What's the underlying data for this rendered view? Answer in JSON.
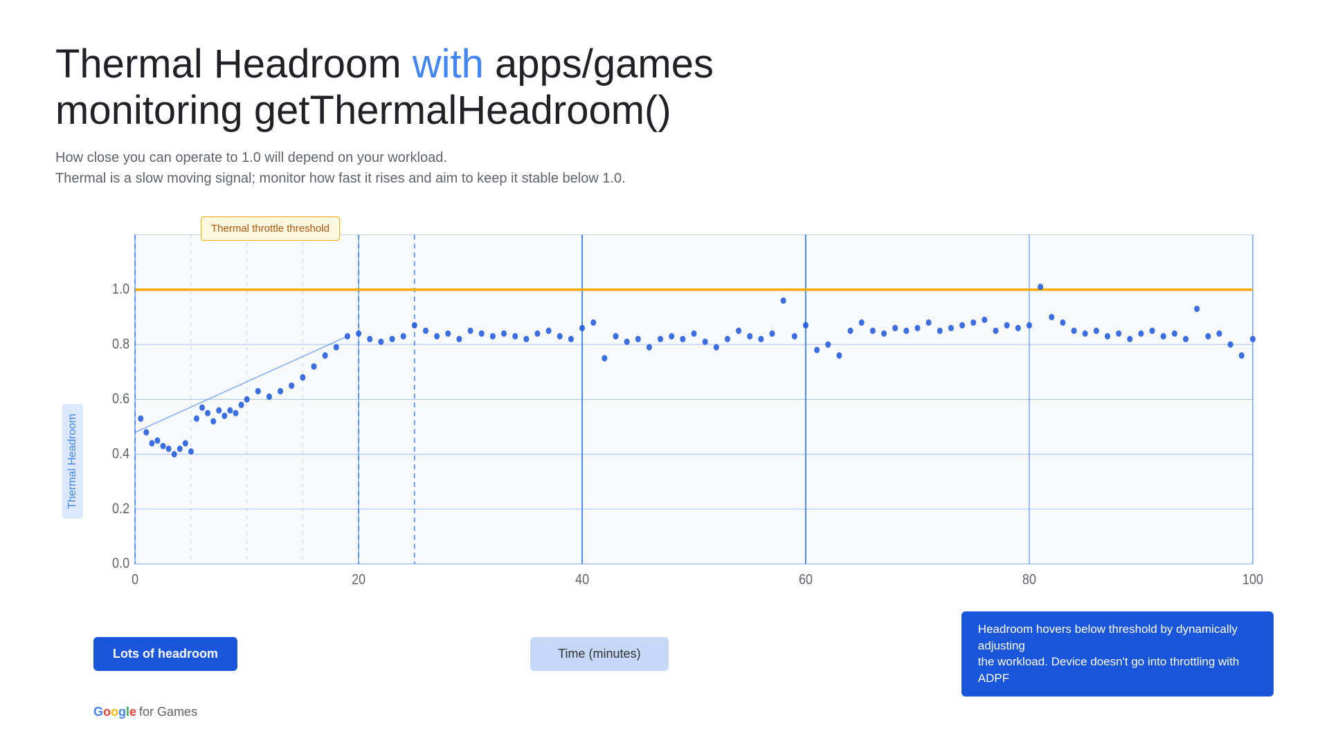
{
  "title": {
    "part1": "Thermal Headroom ",
    "with": "with",
    "part2": " apps/games",
    "line2": "monitoring getThermalHeadroom()"
  },
  "subtitle": {
    "line1": "How close you can operate to 1.0 will depend on your workload.",
    "line2": "Thermal is a slow moving signal; monitor how fast it rises and aim to keep it stable below 1.0."
  },
  "chart": {
    "y_axis_label": "Thermal Headroom",
    "x_axis_label": "Time (minutes)",
    "y_ticks": [
      "1.0",
      "0.8",
      "0.6",
      "0.4",
      "0.2",
      "0.0"
    ],
    "x_ticks": [
      "0",
      "20",
      "40",
      "60",
      "80",
      "100"
    ],
    "threshold_label": "Thermal throttle threshold",
    "threshold_value": 1.0
  },
  "labels": {
    "lots_headroom": "Lots of headroom",
    "time_minutes": "Time (minutes)",
    "headroom_desc": "Headroom hovers below threshold by dynamically adjusting\nthe workload. Device doesn't go into throttling with ADPF"
  },
  "google_logo": {
    "text": "Google",
    "suffix": " for Games"
  },
  "colors": {
    "blue": "#4285F4",
    "yellow": "#f9ab00",
    "dark_blue": "#1a56db",
    "red": "#EA4335",
    "green": "#34A853",
    "text_dark": "#202124",
    "text_gray": "#5f6368"
  },
  "data_points": [
    {
      "t": 0.5,
      "v": 0.53
    },
    {
      "t": 1.0,
      "v": 0.48
    },
    {
      "t": 1.5,
      "v": 0.44
    },
    {
      "t": 2.0,
      "v": 0.45
    },
    {
      "t": 2.5,
      "v": 0.43
    },
    {
      "t": 3.0,
      "v": 0.42
    },
    {
      "t": 3.5,
      "v": 0.4
    },
    {
      "t": 4.0,
      "v": 0.42
    },
    {
      "t": 4.5,
      "v": 0.44
    },
    {
      "t": 5.0,
      "v": 0.41
    },
    {
      "t": 5.5,
      "v": 0.53
    },
    {
      "t": 6.0,
      "v": 0.57
    },
    {
      "t": 6.5,
      "v": 0.55
    },
    {
      "t": 7.0,
      "v": 0.52
    },
    {
      "t": 7.5,
      "v": 0.56
    },
    {
      "t": 8.0,
      "v": 0.54
    },
    {
      "t": 8.5,
      "v": 0.56
    },
    {
      "t": 9.0,
      "v": 0.55
    },
    {
      "t": 9.5,
      "v": 0.58
    },
    {
      "t": 10.0,
      "v": 0.6
    },
    {
      "t": 11.0,
      "v": 0.63
    },
    {
      "t": 12.0,
      "v": 0.61
    },
    {
      "t": 13.0,
      "v": 0.63
    },
    {
      "t": 14.0,
      "v": 0.65
    },
    {
      "t": 15.0,
      "v": 0.68
    },
    {
      "t": 16.0,
      "v": 0.72
    },
    {
      "t": 17.0,
      "v": 0.76
    },
    {
      "t": 18.0,
      "v": 0.79
    },
    {
      "t": 19.0,
      "v": 0.83
    },
    {
      "t": 20.0,
      "v": 0.84
    },
    {
      "t": 21.0,
      "v": 0.82
    },
    {
      "t": 22.0,
      "v": 0.81
    },
    {
      "t": 23.0,
      "v": 0.82
    },
    {
      "t": 24.0,
      "v": 0.83
    },
    {
      "t": 25.0,
      "v": 0.87
    },
    {
      "t": 26.0,
      "v": 0.85
    },
    {
      "t": 27.0,
      "v": 0.83
    },
    {
      "t": 28.0,
      "v": 0.84
    },
    {
      "t": 29.0,
      "v": 0.82
    },
    {
      "t": 30.0,
      "v": 0.85
    },
    {
      "t": 31.0,
      "v": 0.84
    },
    {
      "t": 32.0,
      "v": 0.83
    },
    {
      "t": 33.0,
      "v": 0.84
    },
    {
      "t": 34.0,
      "v": 0.83
    },
    {
      "t": 35.0,
      "v": 0.82
    },
    {
      "t": 36.0,
      "v": 0.84
    },
    {
      "t": 37.0,
      "v": 0.85
    },
    {
      "t": 38.0,
      "v": 0.83
    },
    {
      "t": 39.0,
      "v": 0.82
    },
    {
      "t": 40.0,
      "v": 0.86
    },
    {
      "t": 41.0,
      "v": 0.88
    },
    {
      "t": 42.0,
      "v": 0.75
    },
    {
      "t": 43.0,
      "v": 0.83
    },
    {
      "t": 44.0,
      "v": 0.81
    },
    {
      "t": 45.0,
      "v": 0.82
    },
    {
      "t": 46.0,
      "v": 0.79
    },
    {
      "t": 47.0,
      "v": 0.82
    },
    {
      "t": 48.0,
      "v": 0.83
    },
    {
      "t": 49.0,
      "v": 0.82
    },
    {
      "t": 50.0,
      "v": 0.84
    },
    {
      "t": 51.0,
      "v": 0.81
    },
    {
      "t": 52.0,
      "v": 0.79
    },
    {
      "t": 53.0,
      "v": 0.82
    },
    {
      "t": 54.0,
      "v": 0.85
    },
    {
      "t": 55.0,
      "v": 0.83
    },
    {
      "t": 56.0,
      "v": 0.82
    },
    {
      "t": 57.0,
      "v": 0.84
    },
    {
      "t": 58.0,
      "v": 0.96
    },
    {
      "t": 59.0,
      "v": 0.83
    },
    {
      "t": 60.0,
      "v": 0.87
    },
    {
      "t": 61.0,
      "v": 0.78
    },
    {
      "t": 62.0,
      "v": 0.8
    },
    {
      "t": 63.0,
      "v": 0.76
    },
    {
      "t": 64.0,
      "v": 0.85
    },
    {
      "t": 65.0,
      "v": 0.88
    },
    {
      "t": 66.0,
      "v": 0.85
    },
    {
      "t": 67.0,
      "v": 0.84
    },
    {
      "t": 68.0,
      "v": 0.86
    },
    {
      "t": 69.0,
      "v": 0.85
    },
    {
      "t": 70.0,
      "v": 0.86
    },
    {
      "t": 71.0,
      "v": 0.88
    },
    {
      "t": 72.0,
      "v": 0.85
    },
    {
      "t": 73.0,
      "v": 0.86
    },
    {
      "t": 74.0,
      "v": 0.87
    },
    {
      "t": 75.0,
      "v": 0.88
    },
    {
      "t": 76.0,
      "v": 0.89
    },
    {
      "t": 77.0,
      "v": 0.85
    },
    {
      "t": 78.0,
      "v": 0.87
    },
    {
      "t": 79.0,
      "v": 0.86
    },
    {
      "t": 80.0,
      "v": 0.87
    },
    {
      "t": 81.0,
      "v": 1.01
    },
    {
      "t": 82.0,
      "v": 0.9
    },
    {
      "t": 83.0,
      "v": 0.88
    },
    {
      "t": 84.0,
      "v": 0.85
    },
    {
      "t": 85.0,
      "v": 0.84
    },
    {
      "t": 86.0,
      "v": 0.85
    },
    {
      "t": 87.0,
      "v": 0.83
    },
    {
      "t": 88.0,
      "v": 0.84
    },
    {
      "t": 89.0,
      "v": 0.82
    },
    {
      "t": 90.0,
      "v": 0.84
    },
    {
      "t": 91.0,
      "v": 0.85
    },
    {
      "t": 92.0,
      "v": 0.83
    },
    {
      "t": 93.0,
      "v": 0.84
    },
    {
      "t": 94.0,
      "v": 0.82
    },
    {
      "t": 95.0,
      "v": 0.93
    },
    {
      "t": 96.0,
      "v": 0.83
    },
    {
      "t": 97.0,
      "v": 0.84
    },
    {
      "t": 98.0,
      "v": 0.8
    },
    {
      "t": 99.0,
      "v": 0.76
    },
    {
      "t": 100.0,
      "v": 0.82
    }
  ]
}
